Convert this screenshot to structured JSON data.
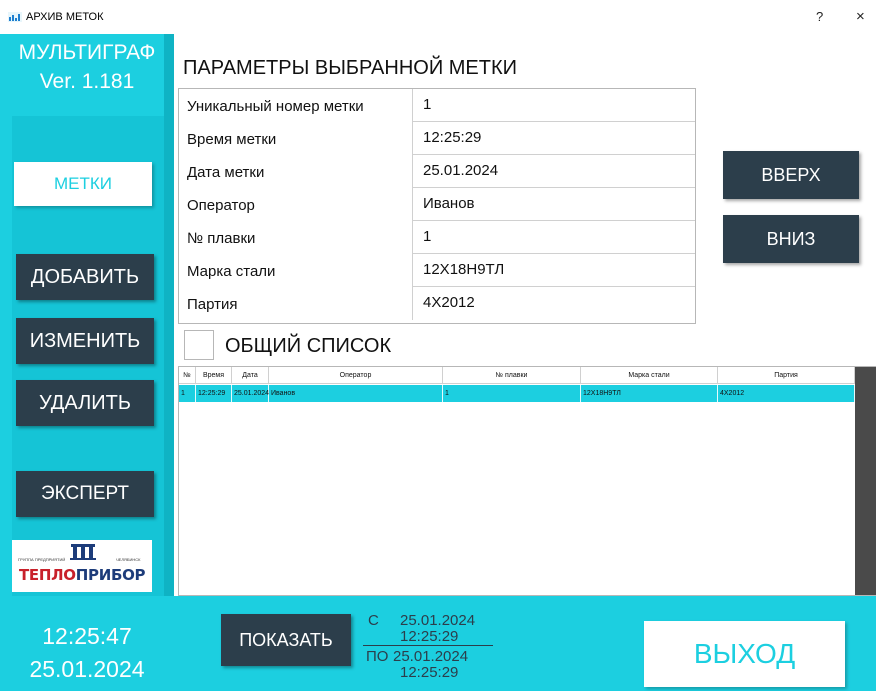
{
  "window": {
    "title": "АРХИВ МЕТОК",
    "help": "?",
    "close": "×"
  },
  "sidebar": {
    "brand_line1": "МУЛЬТИГРАФ",
    "brand_line2": "Ver. 1.181",
    "metki": "МЕТКИ",
    "add": "ДОБАВИТЬ",
    "edit": "ИЗМЕНИТЬ",
    "delete": "УДАЛИТЬ",
    "expert": "ЭКСПЕРТ",
    "logo": {
      "small_left": "ГРУППА ПРЕДПРИЯТИЙ",
      "small_right": "ЧЕЛЯБИНСК",
      "word1": "ТЕПЛО",
      "word2": "ПРИБОР"
    },
    "clock_time": "12:25:47",
    "clock_date": "25.01.2024"
  },
  "params": {
    "title": "ПАРАМЕТРЫ ВЫБРАННОЙ МЕТКИ",
    "rows": [
      {
        "label": "Уникальный номер метки",
        "value": "1"
      },
      {
        "label": "Время метки",
        "value": "12:25:29"
      },
      {
        "label": "Дата метки",
        "value": "25.01.2024"
      },
      {
        "label": "Оператор",
        "value": "Иванов"
      },
      {
        "label": "№ плавки",
        "value": "1"
      },
      {
        "label": "Марка стали",
        "value": "12Х18Н9ТЛ"
      },
      {
        "label": "Партия",
        "value": "4Х2012"
      }
    ]
  },
  "nav": {
    "up": "ВВЕРХ",
    "down": "ВНИЗ"
  },
  "common_list": {
    "label": "ОБЩИЙ СПИСОК",
    "checked": false
  },
  "grid": {
    "headers": [
      "№",
      "Время",
      "Дата",
      "Оператор",
      "№ плавки",
      "Марка стали",
      "Партия"
    ],
    "rows": [
      [
        "1",
        "12:25:29",
        "25.01.2024",
        "Иванов",
        "1",
        "12Х18Н9ТЛ",
        "4Х2012"
      ]
    ]
  },
  "bottom": {
    "show": "ПОКАЗАТЬ",
    "from_label": "С",
    "from_date": "25.01.2024",
    "from_time": "12:25:29",
    "to_label": "ПО",
    "to_date": "25.01.2024",
    "to_time": "12:25:29",
    "exit": "ВЫХОД"
  },
  "colors": {
    "accent": "#1ccfe0",
    "dark_button": "#2c3e4b",
    "selected_row": "#1ccfe0"
  }
}
